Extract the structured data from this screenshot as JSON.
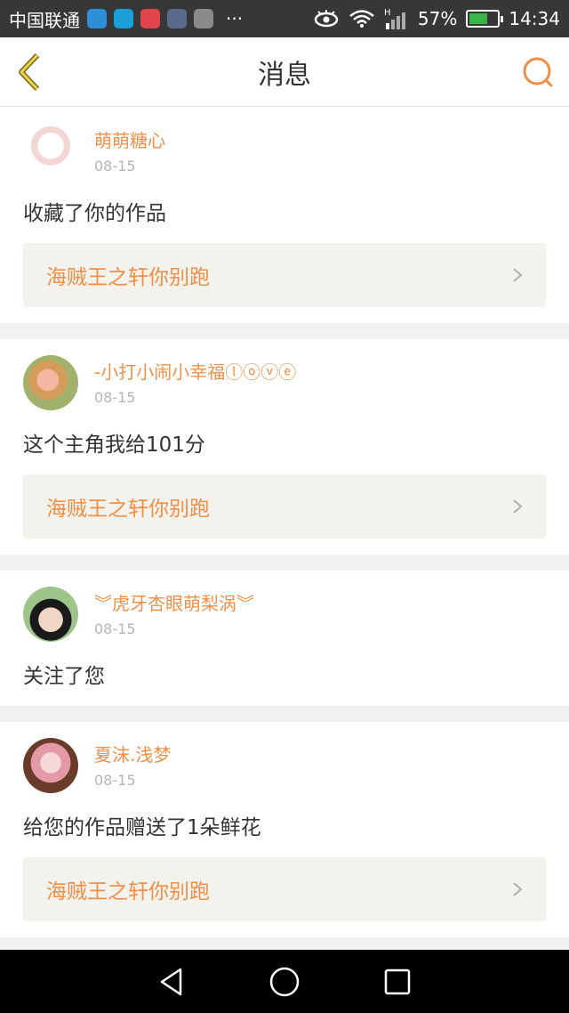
{
  "status_bar": {
    "carrier": "中国联通",
    "more": "···",
    "battery": "57%",
    "time": "14:34",
    "network": "H"
  },
  "header": {
    "title": "消息",
    "back_icon": "chevron-left-icon",
    "search_icon": "search-icon",
    "accent_color": "#f09048"
  },
  "messages": [
    {
      "username": "萌萌糖心",
      "date": "08-15",
      "text": "收藏了你的作品",
      "work_title": "海贼王之轩你别跑"
    },
    {
      "username": "-小打小闹小幸福ⓛⓞⓥⓔ",
      "date": "08-15",
      "text": "这个主角我给101分",
      "work_title": "海贼王之轩你别跑"
    },
    {
      "username": "︾虎牙杏眼萌梨涡︾",
      "date": "08-15",
      "text": "关注了您"
    },
    {
      "username": "夏沫.浅梦",
      "date": "08-15",
      "text": "给您的作品赠送了1朵鲜花",
      "work_title": "海贼王之轩你别跑"
    }
  ]
}
